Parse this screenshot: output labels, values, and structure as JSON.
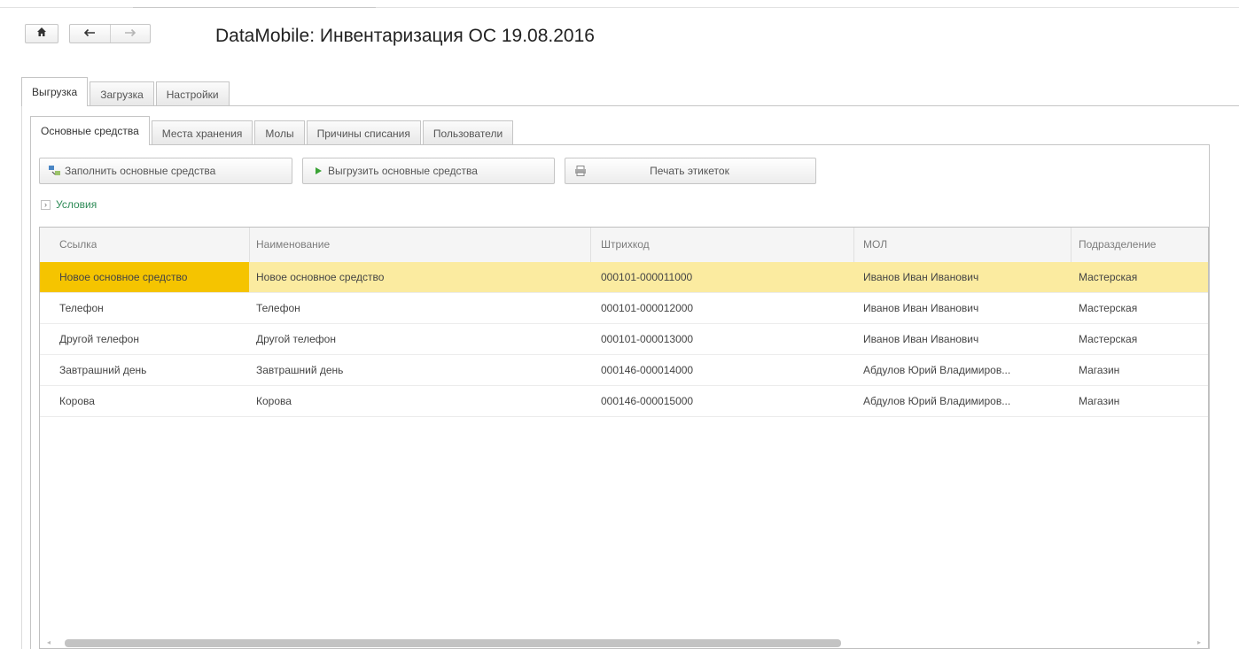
{
  "window": {
    "title": "DataMobile: Инвентаризация ОС 19.08.2016"
  },
  "icons": {
    "home": "home-icon",
    "back": "arrow-left-icon",
    "forward": "arrow-right-icon"
  },
  "top_tabs": [
    {
      "label": "Выгрузка",
      "active": true
    },
    {
      "label": "Загрузка",
      "active": false
    },
    {
      "label": "Настройки",
      "active": false
    }
  ],
  "sub_tabs": [
    {
      "label": "Основные средства",
      "active": true
    },
    {
      "label": "Места хранения",
      "active": false
    },
    {
      "label": "Молы",
      "active": false
    },
    {
      "label": "Причины списания",
      "active": false
    },
    {
      "label": "Пользователи",
      "active": false
    }
  ],
  "toolbar": {
    "fill_label": "Заполнить основные средства",
    "export_label": "Выгрузить основные средства",
    "print_label": "Печать этикеток"
  },
  "conditions_label": "Условия",
  "table": {
    "columns": [
      "Ссылка",
      "Наименование",
      "Штрихкод",
      "МОЛ",
      "Подразделение"
    ],
    "rows": [
      [
        "Новое основное средство",
        "Новое основное средство",
        "000101-000011000",
        "Иванов Иван Иванович",
        "Мастерская"
      ],
      [
        "Телефон",
        "Телефон",
        "000101-000012000",
        "Иванов Иван Иванович",
        "Мастерская"
      ],
      [
        "Другой телефон",
        "Другой телефон",
        "000101-000013000",
        "Иванов Иван Иванович",
        "Мастерская"
      ],
      [
        "Завтрашний день",
        "Завтрашний день",
        "000146-000014000",
        "Абдулов Юрий Владимиров...",
        "Магазин"
      ],
      [
        "Корова",
        "Корова",
        "000146-000015000",
        "Абдулов Юрий Владимиров...",
        "Магазин"
      ]
    ],
    "selected_row": 0
  },
  "colors": {
    "selected_row": "#fbeba0",
    "selected_cell": "#f5c400",
    "conditions_text": "#2e8b57"
  }
}
